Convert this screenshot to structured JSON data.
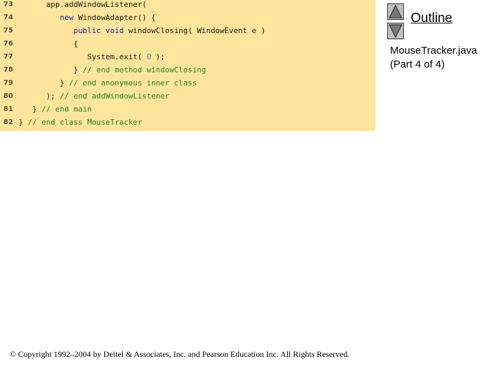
{
  "code": {
    "lines": [
      {
        "num": "73",
        "indent": "      ",
        "parts": [
          {
            "t": "app.addWindowListener(",
            "c": "id"
          }
        ]
      },
      {
        "num": "74",
        "indent": "         ",
        "parts": [
          {
            "t": "new",
            "c": "kw"
          },
          {
            "t": " WindowAdapter() {",
            "c": "id"
          }
        ]
      },
      {
        "num": "75",
        "indent": "            ",
        "parts": [
          {
            "t": "public",
            "c": "kw"
          },
          {
            "t": " ",
            "c": "id"
          },
          {
            "t": "void",
            "c": "kw"
          },
          {
            "t": " windowClosing( WindowEvent e )",
            "c": "id"
          }
        ]
      },
      {
        "num": "76",
        "indent": "            ",
        "parts": [
          {
            "t": "{",
            "c": "id"
          }
        ]
      },
      {
        "num": "77",
        "indent": "               ",
        "parts": [
          {
            "t": "System.exit( ",
            "c": "id"
          },
          {
            "t": "0",
            "c": "num"
          },
          {
            "t": " );",
            "c": "id"
          }
        ]
      },
      {
        "num": "78",
        "indent": "            ",
        "parts": [
          {
            "t": "} ",
            "c": "id"
          },
          {
            "t": "// end method windowClosing",
            "c": "cm"
          }
        ]
      },
      {
        "num": "79",
        "indent": "         ",
        "parts": [
          {
            "t": "} ",
            "c": "id"
          },
          {
            "t": "// end anonymous inner class",
            "c": "cm"
          }
        ]
      },
      {
        "num": "80",
        "indent": "      ",
        "parts": [
          {
            "t": "); ",
            "c": "id"
          },
          {
            "t": "// end addWindowListener",
            "c": "cm"
          }
        ]
      },
      {
        "num": "81",
        "indent": "   ",
        "parts": [
          {
            "t": "} ",
            "c": "id"
          },
          {
            "t": "// end main",
            "c": "cm"
          }
        ]
      },
      {
        "num": "82",
        "indent": "",
        "parts": [
          {
            "t": "} ",
            "c": "id"
          },
          {
            "t": "// end class MouseTracker",
            "c": "cm"
          }
        ]
      }
    ]
  },
  "nav": {
    "up_icon": "triangle-up-icon",
    "down_icon": "triangle-down-icon",
    "outline_label": "Outline"
  },
  "file": {
    "name": "MouseTracker.java",
    "part": "(Part 4 of 4)"
  },
  "footer": {
    "copyright": "© Copyright 1992–2004 by Deitel & Associates, Inc. and Pearson Education Inc. All Rights Reserved."
  },
  "colors": {
    "code_bg": "#ffe49c",
    "keyword": "#1f1fa8",
    "comment": "#1e8a1e",
    "literal": "#2a9fb0"
  }
}
